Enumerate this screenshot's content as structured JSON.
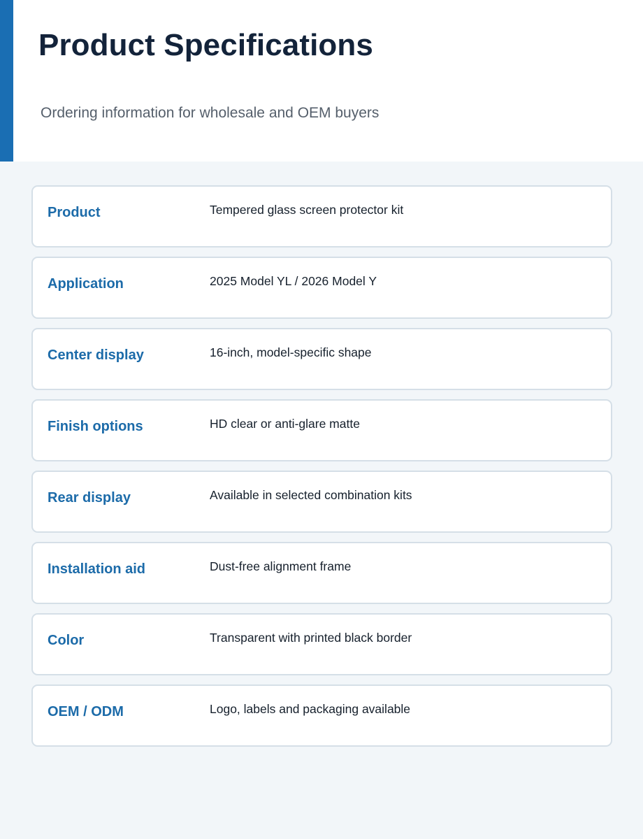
{
  "header": {
    "title": "Product Specifications",
    "subtitle": "Ordering information for wholesale and OEM buyers"
  },
  "specs": [
    {
      "label": "Product",
      "value": "Tempered glass screen protector kit"
    },
    {
      "label": "Application",
      "value": "2025 Model YL / 2026 Model Y"
    },
    {
      "label": "Center display",
      "value": "16-inch, model-specific shape"
    },
    {
      "label": "Finish options",
      "value": "HD clear or anti-glare matte"
    },
    {
      "label": "Rear display",
      "value": "Available in selected combination kits"
    },
    {
      "label": "Installation aid",
      "value": "Dust-free alignment frame"
    },
    {
      "label": "Color",
      "value": "Transparent with printed black border"
    },
    {
      "label": "OEM / ODM",
      "value": "Logo, labels and packaging available"
    }
  ],
  "colors": {
    "accent": "#1a6eb3",
    "label": "#1c6ba9",
    "title": "#13233a",
    "background": "#f2f6f9"
  }
}
